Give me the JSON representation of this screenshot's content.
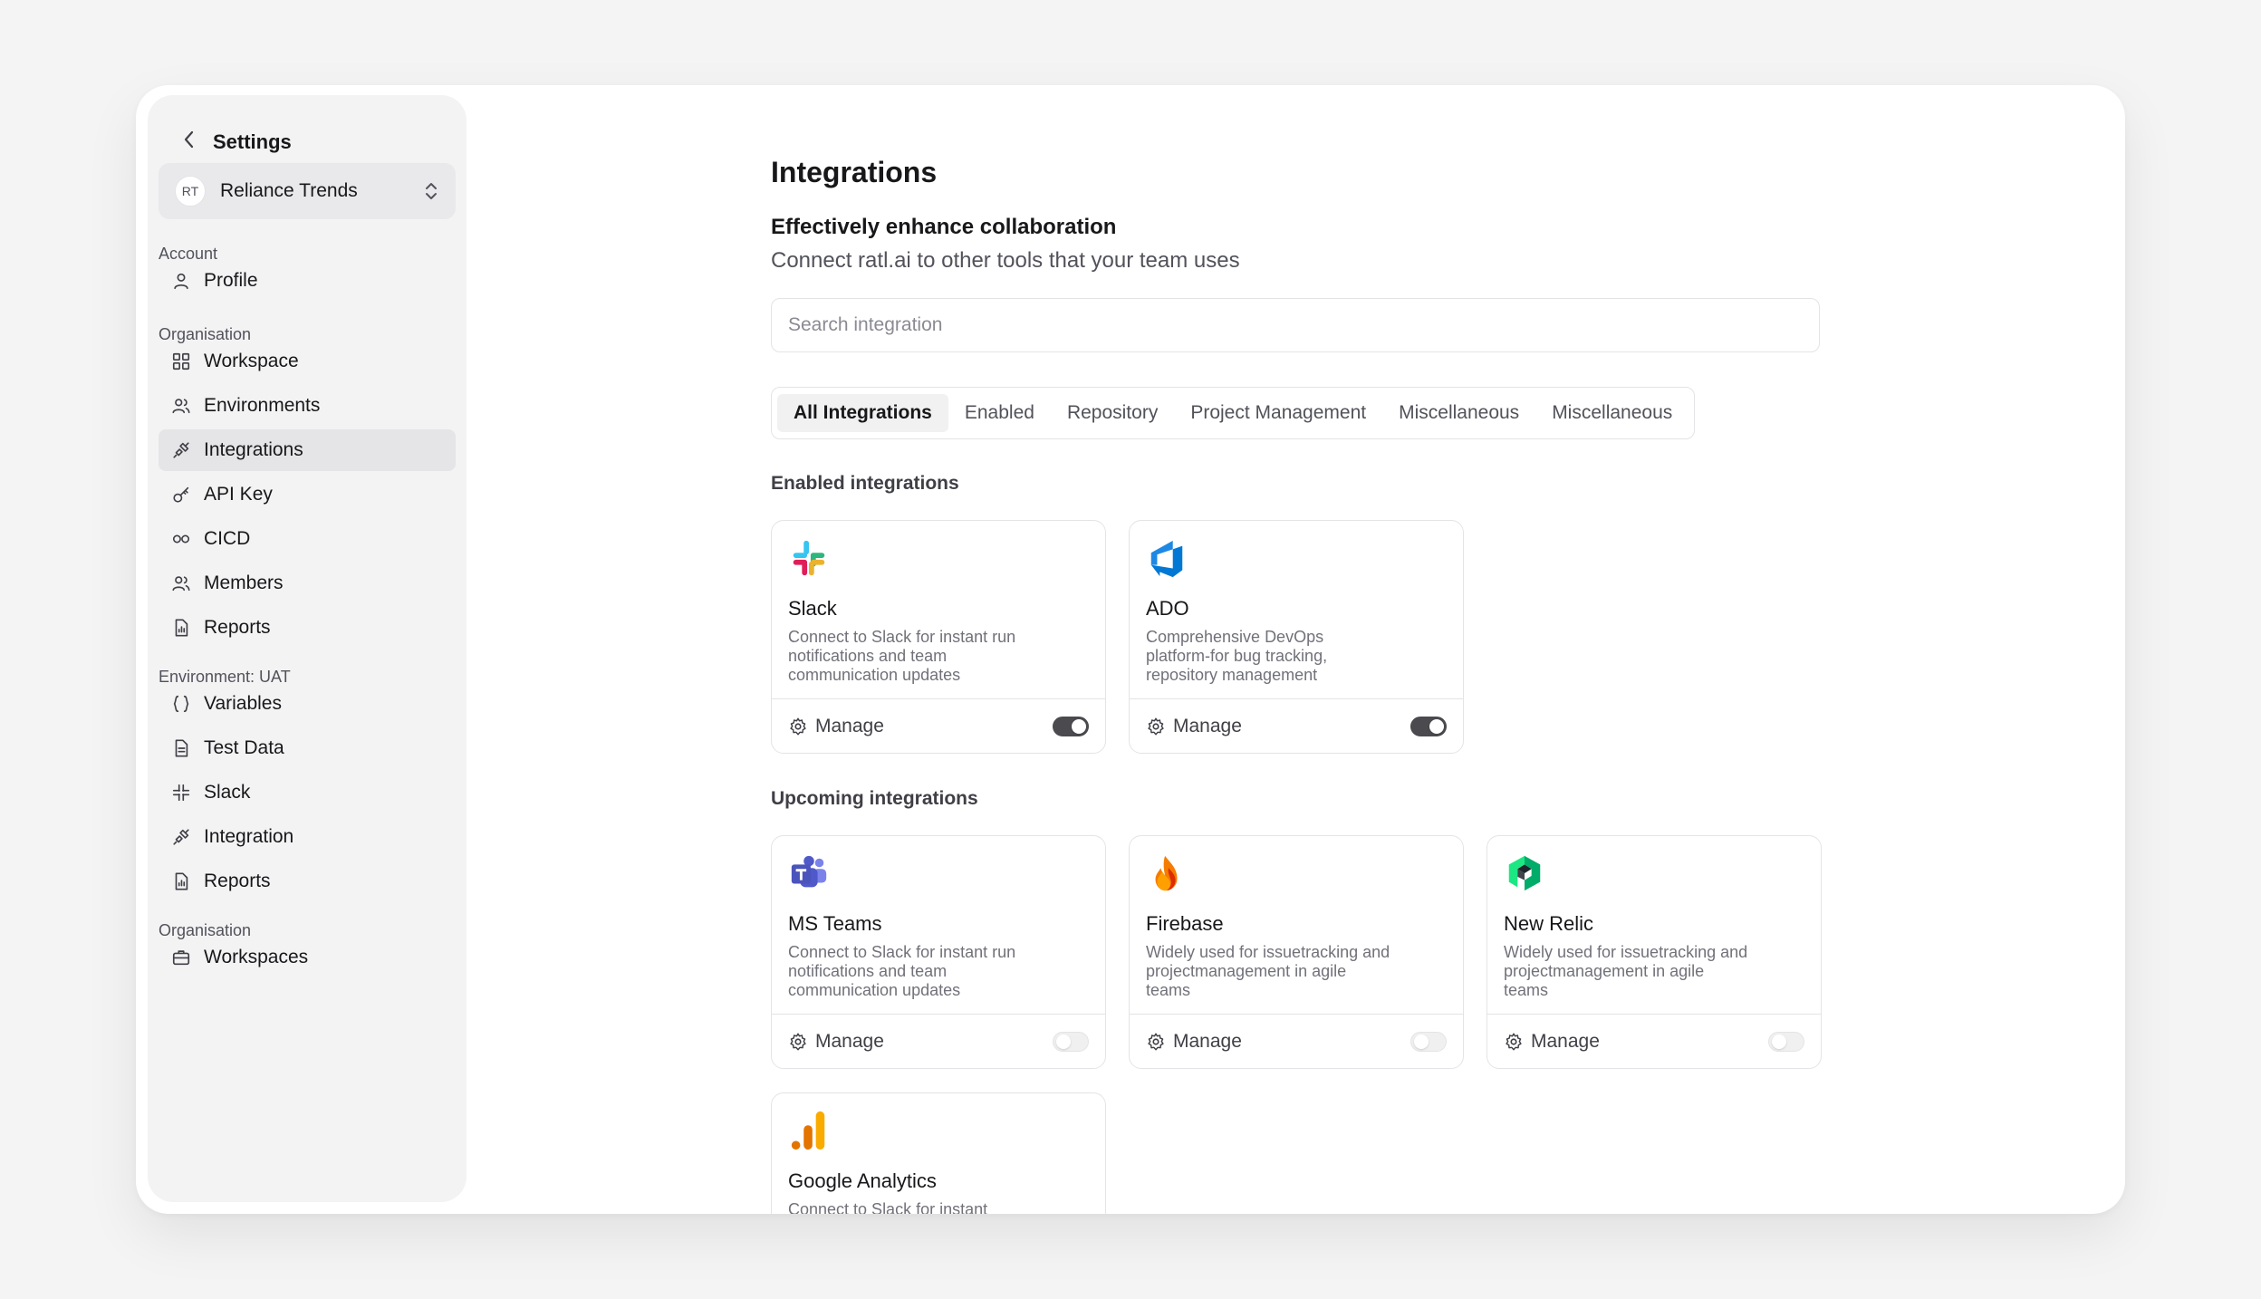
{
  "sidebar": {
    "back_title": "Settings",
    "org": {
      "initials": "RT",
      "name": "Reliance Trends"
    },
    "sections": [
      "Account",
      "Organisation",
      "Environment: UAT",
      "Organisation"
    ],
    "items": [
      {
        "label": "Profile",
        "icon": "user-icon"
      },
      {
        "label": "Workspace",
        "icon": "grid-icon"
      },
      {
        "label": "Environments",
        "icon": "users-icon"
      },
      {
        "label": "Integrations",
        "icon": "plug-icon",
        "active": true
      },
      {
        "label": "API Key",
        "icon": "key-icon"
      },
      {
        "label": "CICD",
        "icon": "infinity-icon"
      },
      {
        "label": "Members",
        "icon": "users-icon"
      },
      {
        "label": "Reports",
        "icon": "report-icon"
      },
      {
        "label": "Variables",
        "icon": "braces-icon"
      },
      {
        "label": "Test Data",
        "icon": "file-icon"
      },
      {
        "label": "Slack",
        "icon": "slack-icon"
      },
      {
        "label": "Integration",
        "icon": "plug-icon"
      },
      {
        "label": "Reports",
        "icon": "report-icon"
      },
      {
        "label": "Workspaces",
        "icon": "briefcase-icon"
      }
    ]
  },
  "main": {
    "title": "Integrations",
    "subtitle": "Effectively enhance collaboration",
    "description": "Connect ratl.ai to other tools that your team uses",
    "search_placeholder": "Search integration",
    "tabs": [
      "All Integrations",
      "Enabled",
      "Repository",
      "Project Management",
      "Miscellaneous",
      "Miscellaneous"
    ],
    "active_tab": "All Integrations",
    "enabled_label": "Enabled integrations",
    "upcoming_label": "Upcoming integrations",
    "manage_label": "Manage",
    "enabled": [
      {
        "name": "Slack",
        "description": "Connect to Slack for instant run notifications and team communication updates",
        "toggle": "on",
        "logo": "slack-logo"
      },
      {
        "name": "ADO",
        "description": "Comprehensive DevOps platform-for bug tracking, repository management",
        "toggle": "on",
        "logo": "azure-devops-logo"
      }
    ],
    "upcoming": [
      {
        "name": "MS Teams",
        "description": "Connect to Slack for instant run notifications and team communication updates",
        "toggle": "off",
        "logo": "ms-teams-logo"
      },
      {
        "name": "Firebase",
        "description": "Widely used for issuetracking and projectmanagement in agile teams",
        "toggle": "off",
        "logo": "firebase-logo"
      },
      {
        "name": "New Relic",
        "description": "Widely used for issuetracking and projectmanagement in agile teams",
        "toggle": "off",
        "logo": "new-relic-logo"
      },
      {
        "name": "Google Analytics",
        "description": "Connect to Slack for instant",
        "toggle": "off",
        "logo": "google-analytics-logo"
      }
    ]
  },
  "colors": {
    "page_bg": "#f4f4f4",
    "sidebar_bg": "#f3f3f4",
    "active_item_bg": "#e5e5e7",
    "toggle_on": "#4a4a4f"
  }
}
